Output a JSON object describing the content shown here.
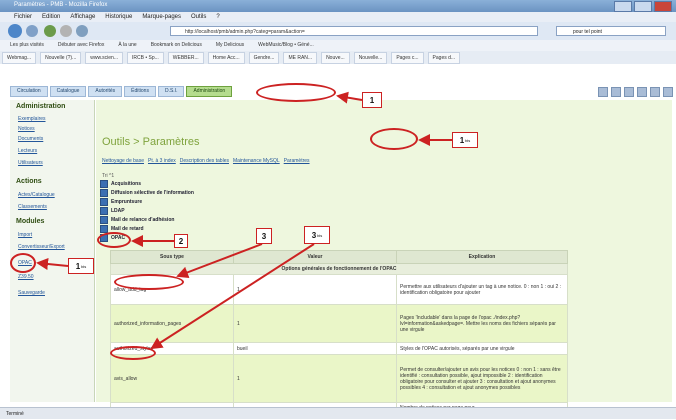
{
  "window": {
    "title": "Paramètres - PMB - Mozilla Firefox"
  },
  "menu": [
    "Fichier",
    "Edition",
    "Affichage",
    "Historique",
    "Marque-pages",
    "Outils",
    "?"
  ],
  "urlbar": {
    "value": "http://localhost/pmb/admin.php?categ=param&action="
  },
  "searchbar": {
    "placeholder": "pour tel point"
  },
  "bookmarks_row1": [
    "Les plus visités",
    "Débuter avec Firefox",
    "À la une",
    "Bookmark on Delicious",
    "My Delicious",
    "WebMusic/Blog • Géné..."
  ],
  "bookmarks_row2": [
    "Webmag...",
    "Nouvelle (?)...",
    "www.scien...",
    "IRCB • Sp...",
    "WEBBER...",
    "Home Acc...",
    "Gendre...",
    "ME RAN...",
    "Nouve...",
    "Nouvelle...",
    "Pages c...",
    "Pages d..."
  ],
  "app_tabs": [
    "Circulation",
    "Catalogue",
    "Autorités",
    "Éditions",
    "D.S.I.",
    "Administration"
  ],
  "sidebar": {
    "section1": "Administration",
    "links1": [
      "Exemplaires",
      "Notices",
      "Documents",
      "Lecteurs",
      "Utilisateurs"
    ],
    "section2": "Actions",
    "links2": [
      "Actes/Catalogue",
      "Classements"
    ],
    "section3": "Modules",
    "links3": [
      "Import",
      "Convertisseur/Export",
      "OPAC",
      "Z39.50",
      "Sauvegarde"
    ]
  },
  "main": {
    "title": "Outils > Paramètres",
    "links": [
      "Nettoyage de base",
      "Pt. à 3 index",
      "Description des tables",
      "Maintenance MySQL",
      "Paramètres"
    ],
    "section_label": "Tri ^1",
    "checkboxes": [
      "Acquisitions",
      "Diffusion sélective de l'information",
      "Empruntsure",
      "LDAP",
      "Mail de relance d'adhésion",
      "Mail de retard",
      "OPAC"
    ]
  },
  "table": {
    "headers": [
      "Sous type",
      "Valeur",
      "Explication"
    ],
    "section_row": "Options générales de fonctionnement de l'OPAC",
    "rows": [
      {
        "name": "allow_add_tag",
        "value": "1",
        "explication": "Permettre aux utilisateurs d'ajouter un tag à une notice. 0 : non 1 : oui 2 : identification obligatoire pour ajouter"
      },
      {
        "name": "authorized_information_pages",
        "value": "1",
        "explication": "Pages 'Includable' dans la page de l'opac ./index.php?lvl=information&askedpage=. Mettre les noms des fichiers séparés par une virgule"
      },
      {
        "name": "authorized_styles",
        "value": "bueil",
        "explication": "Styles de l'OPAC autorisés, séparés par une virgule"
      },
      {
        "name": "avis_allow",
        "value": "1",
        "explication": "Permet de consulter/ajouter un avis pour les notices 0 : non 1 : sans être identifié : consultation possible, ajout impossible 2 : identification obligatoire pour consulter et ajouter 3 : consultation et ajout anonymes possibles 4 : consultation et ajout anonymes possibles"
      },
      {
        "name": "",
        "value": "",
        "explication": "Nombre de notices par page pour..."
      }
    ]
  },
  "callouts": {
    "c1": "1",
    "c1b": "1",
    "c1b_sub": "bis",
    "c2": "2",
    "c3": "3",
    "c3b": "3",
    "c3b_sub": "bis"
  },
  "status": "Terminé",
  "colors": {
    "annotation": "#cc2222",
    "active_tab": "#b5dc8e",
    "title_green": "#7fa33d"
  }
}
